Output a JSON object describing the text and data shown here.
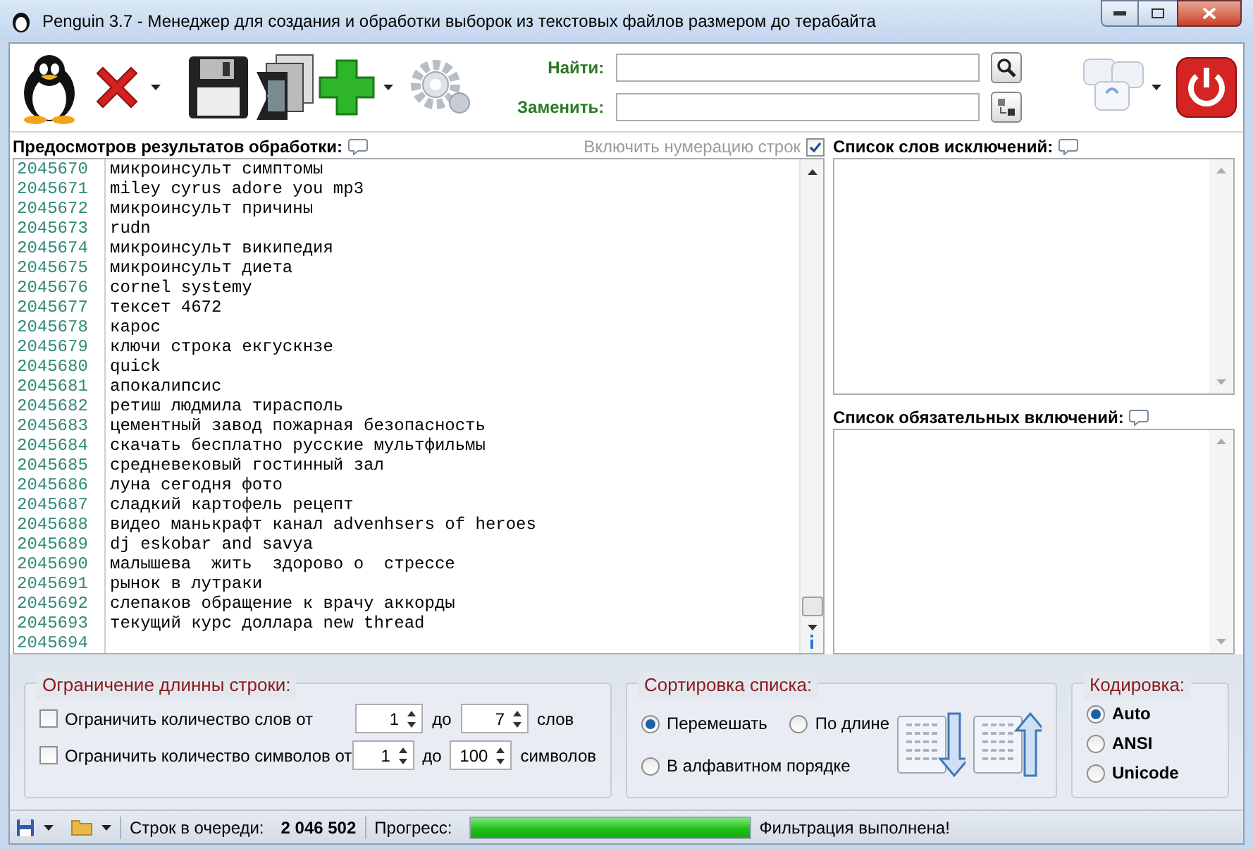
{
  "window": {
    "title": "Penguin 3.7 - Менеджер для создания и обработки выборок из текстовых файлов размером до терабайта"
  },
  "search": {
    "find_label": "Найти:",
    "replace_label": "Заменить:"
  },
  "preview": {
    "title": "Предосмотров результатов обработки:",
    "numbering_label": "Включить нумерацию строк",
    "numbering_checked": true,
    "lines": [
      {
        "num": "2045670",
        "text": "микроинсульт симптомы"
      },
      {
        "num": "2045671",
        "text": "miley cyrus adore you mp3"
      },
      {
        "num": "2045672",
        "text": "микроинсульт причины"
      },
      {
        "num": "2045673",
        "text": "rudn"
      },
      {
        "num": "2045674",
        "text": "микроинсульт википедия"
      },
      {
        "num": "2045675",
        "text": "микроинсульт диета"
      },
      {
        "num": "2045676",
        "text": "cornel systemy"
      },
      {
        "num": "2045677",
        "text": "тексет 4672"
      },
      {
        "num": "2045678",
        "text": "карос"
      },
      {
        "num": "2045679",
        "text": "ключи строка екгускнзе"
      },
      {
        "num": "2045680",
        "text": "quick"
      },
      {
        "num": "2045681",
        "text": "апокалипсис"
      },
      {
        "num": "2045682",
        "text": "ретиш людмила тирасполь"
      },
      {
        "num": "2045683",
        "text": "цементный завод пожарная безопасность"
      },
      {
        "num": "2045684",
        "text": "скачать бесплатно русские мультфильмы"
      },
      {
        "num": "2045685",
        "text": "средневековый гостинный зал"
      },
      {
        "num": "2045686",
        "text": "луна сегодня фото"
      },
      {
        "num": "2045687",
        "text": "сладкий картофель рецепт"
      },
      {
        "num": "2045688",
        "text": "видео манькрафт канал advenhsers of heroes"
      },
      {
        "num": "2045689",
        "text": "dj eskobar and savya"
      },
      {
        "num": "2045690",
        "text": "малышева  жить  здорово о  стрессе"
      },
      {
        "num": "2045691",
        "text": "рынок в лутраки"
      },
      {
        "num": "2045692",
        "text": "слепаков обращение к врачу аккорды"
      },
      {
        "num": "2045693",
        "text": "текущий курс доллара new thread"
      },
      {
        "num": "2045694"
      }
    ]
  },
  "exclusions": {
    "title": "Список слов исключений:"
  },
  "inclusions": {
    "title": "Список обязательных включений:"
  },
  "length_limit": {
    "title": "Ограничение длинны строки:",
    "rows": [
      {
        "label": "Ограничить количество слов от",
        "checked": false,
        "from": "1",
        "to_label": "до",
        "to": "7",
        "unit": "слов"
      },
      {
        "label": "Ограничить количество символов от",
        "checked": false,
        "from": "1",
        "to_label": "до",
        "to": "100",
        "unit": "символов"
      }
    ]
  },
  "sorting": {
    "title": "Сортировка списка:",
    "options": [
      {
        "label": "Перемешать",
        "selected": true
      },
      {
        "label": "По длине",
        "selected": false
      },
      {
        "label": "В алфавитном порядке",
        "selected": false
      }
    ]
  },
  "encoding": {
    "title": "Кодировка:",
    "options": [
      {
        "label": "Auto",
        "selected": true
      },
      {
        "label": "ANSI",
        "selected": false
      },
      {
        "label": "Unicode",
        "selected": false
      }
    ]
  },
  "status": {
    "queue_label": "Строк в очереди:",
    "queue_value": "2 046 502",
    "progress_label": "Прогресс:",
    "level": 1,
    "message": "Фильтрация выполнена!"
  }
}
